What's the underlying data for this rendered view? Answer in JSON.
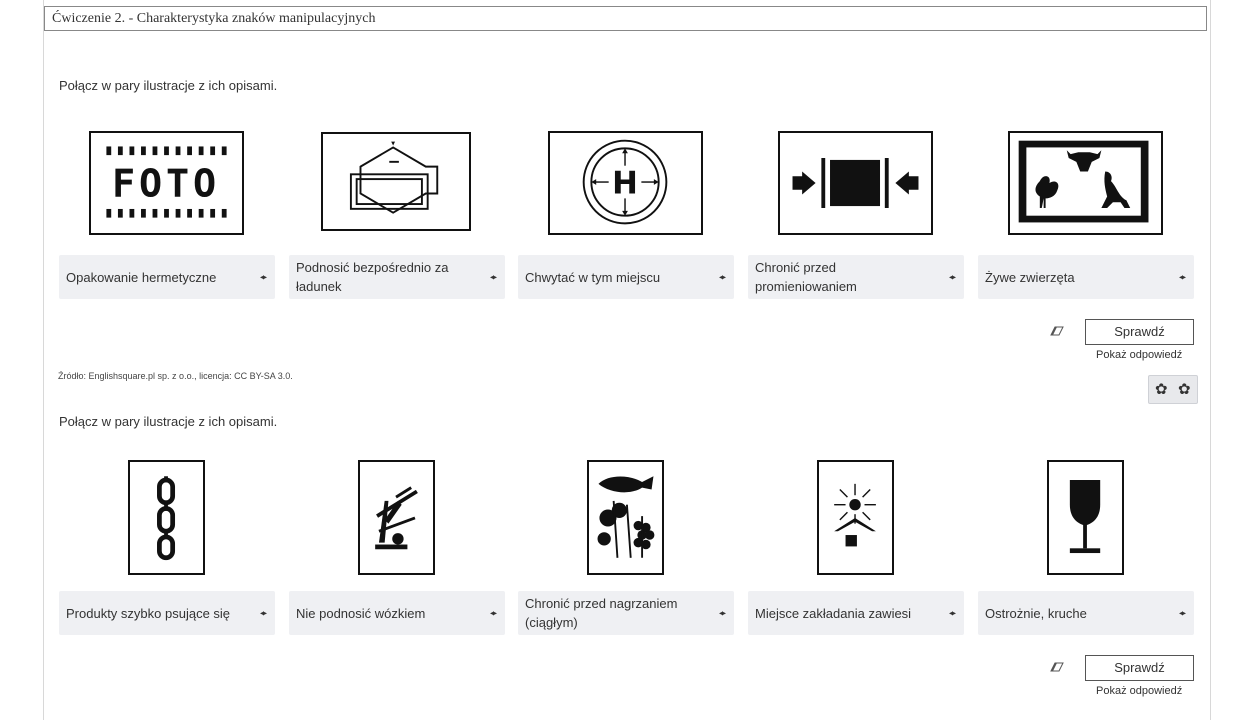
{
  "exercise": {
    "title": "Ćwiczenie 2. - Charakterystyka znaków manipulacyjnych"
  },
  "section1": {
    "instruction": "Połącz w pary ilustracje z ich opisami.",
    "cards": [
      {
        "label": "Opakowanie hermetyczne",
        "arrows": "◂▸"
      },
      {
        "label": "Podnosić bezpośrednio za ładunek",
        "arrows": "◂▸"
      },
      {
        "label": "Chwytać w tym miejscu",
        "arrows": "◂▸"
      },
      {
        "label": "Chronić przed promieniowaniem",
        "arrows": "◂▸"
      },
      {
        "label": "Żywe zwierzęta",
        "arrows": "◂▸"
      }
    ],
    "check_label": "Sprawdź",
    "show_answer_label": "Pokaż odpowiedź",
    "source": "Źródło: Englishsquare.pl sp. z o.o., licencja: CC BY-SA 3.0."
  },
  "section2": {
    "instruction": "Połącz w pary ilustracje z ich opisami.",
    "cards": [
      {
        "label": "Produkty szybko psujące się",
        "arrows": "◂▸"
      },
      {
        "label": "Nie podnosić wózkiem",
        "arrows": "◂▸"
      },
      {
        "label": "Chronić przed nagrzaniem (ciągłym)",
        "arrows": "◂▸"
      },
      {
        "label": "Miejsce zakładania zawiesi",
        "arrows": "◂▸"
      },
      {
        "label": "Ostrożnie, kruche",
        "arrows": "◂▸"
      }
    ],
    "check_label": "Sprawdź",
    "show_answer_label": "Pokaż odpowiedź"
  },
  "foto_sign_text": "FOTO",
  "h_sign_text": "H",
  "icons": {
    "eraser": "eraser-icon",
    "gear": "gear-icon",
    "arrows": "left-right-arrows-icon"
  }
}
